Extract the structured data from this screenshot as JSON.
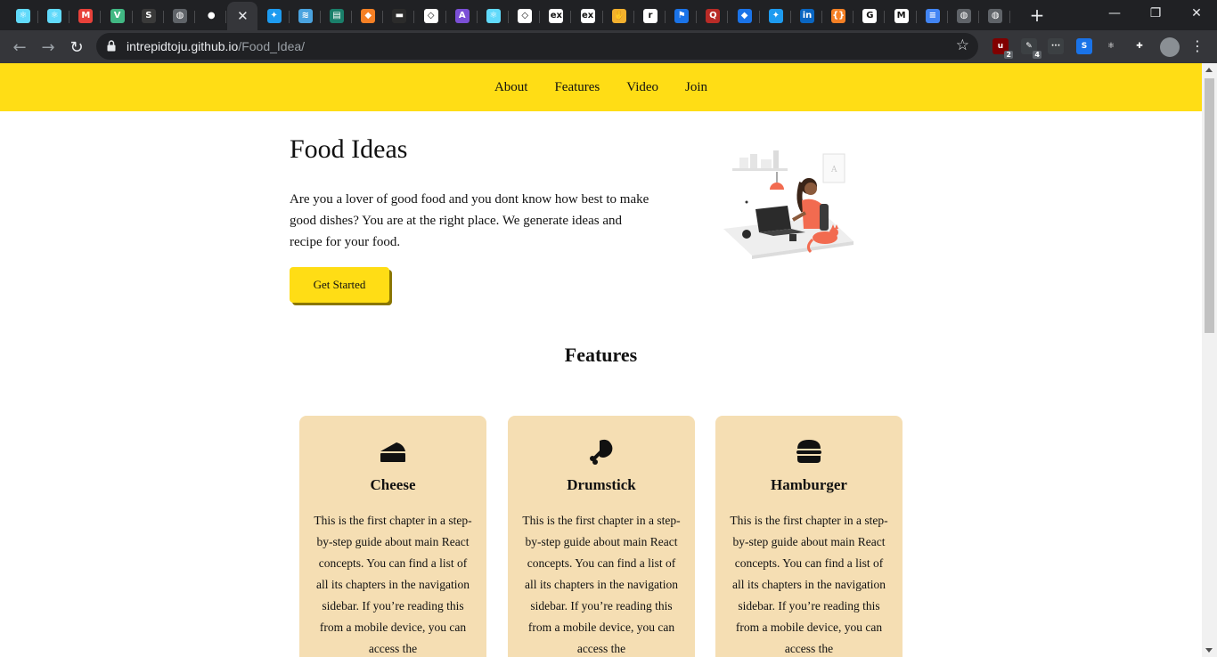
{
  "browser": {
    "tabs": [
      {
        "icon": "react-icon",
        "color": "#61dafb",
        "glyph": "⚛"
      },
      {
        "icon": "react-icon",
        "color": "#61dafb",
        "glyph": "⚛"
      },
      {
        "icon": "m-icon",
        "color": "#e8413a",
        "glyph": "M"
      },
      {
        "icon": "vue-icon",
        "color": "#41b883",
        "glyph": "V"
      },
      {
        "icon": "s-icon",
        "color": "#3a3a3a",
        "glyph": "S"
      },
      {
        "icon": "globe-icon",
        "color": "#5f6368",
        "glyph": "◍"
      },
      {
        "icon": "github-icon",
        "color": "#202124",
        "glyph": "●"
      },
      {
        "icon": "close-icon",
        "color": "#35363a",
        "glyph": "✕",
        "active": true
      },
      {
        "icon": "twitter-icon",
        "color": "#1d9bf0",
        "glyph": "✦"
      },
      {
        "icon": "wifi-icon",
        "color": "#4aa3df",
        "glyph": "≋"
      },
      {
        "icon": "book-icon",
        "color": "#1a7f6a",
        "glyph": "▤"
      },
      {
        "icon": "shield-icon",
        "color": "#f58025",
        "glyph": "◆"
      },
      {
        "icon": "terminal-icon",
        "color": "#2b2b2b",
        "glyph": "▬"
      },
      {
        "icon": "codepen-icon",
        "color": "#ffffff",
        "glyph": "◇"
      },
      {
        "icon": "a-icon",
        "color": "#7b4fd6",
        "glyph": "A"
      },
      {
        "icon": "react-icon",
        "color": "#61dafb",
        "glyph": "⚛"
      },
      {
        "icon": "codepen-icon",
        "color": "#ffffff",
        "glyph": "◇"
      },
      {
        "icon": "ex-icon",
        "color": "#ffffff",
        "glyph": "ex"
      },
      {
        "icon": "ex-icon",
        "color": "#ffffff",
        "glyph": "ex"
      },
      {
        "icon": "hand-icon",
        "color": "#f2b02e",
        "glyph": "✋"
      },
      {
        "icon": "r-icon",
        "color": "#ffffff",
        "glyph": "r"
      },
      {
        "icon": "flag-icon",
        "color": "#1a73e8",
        "glyph": "⚑"
      },
      {
        "icon": "q-icon",
        "color": "#b92b27",
        "glyph": "Q"
      },
      {
        "icon": "diamond-icon",
        "color": "#1a73e8",
        "glyph": "◆"
      },
      {
        "icon": "twitter-icon",
        "color": "#1d9bf0",
        "glyph": "✦"
      },
      {
        "icon": "linkedin-icon",
        "color": "#0a66c2",
        "glyph": "in"
      },
      {
        "icon": "brackets-icon",
        "color": "#f58025",
        "glyph": "{}"
      },
      {
        "icon": "google-icon",
        "color": "#ffffff",
        "glyph": "G"
      },
      {
        "icon": "gmail-icon",
        "color": "#ffffff",
        "glyph": "M"
      },
      {
        "icon": "docs-icon",
        "color": "#4285f4",
        "glyph": "≡"
      },
      {
        "icon": "globe-icon",
        "color": "#5f6368",
        "glyph": "◍"
      },
      {
        "icon": "globe-icon",
        "color": "#5f6368",
        "glyph": "◍"
      }
    ],
    "new_tab_glyph": "+",
    "window_controls": {
      "minimize": "—",
      "restore": "❐",
      "close": "✕"
    },
    "nav": {
      "back": "←",
      "forward": "→",
      "reload": "↻"
    },
    "url": {
      "host": "intrepidtoju.github.io",
      "path": "/Food_Idea/"
    },
    "bookmark_glyph": "☆",
    "extensions": [
      {
        "icon": "ublock-icon",
        "color": "#800000",
        "glyph": "u",
        "badge": "2"
      },
      {
        "icon": "pencil-extension-icon",
        "color": "#3c4043",
        "glyph": "✎",
        "badge": "4"
      },
      {
        "icon": "dots-extension-icon",
        "color": "#3c4043",
        "glyph": "···",
        "badge": ""
      },
      {
        "icon": "s-extension-icon",
        "color": "#1a73e8",
        "glyph": "S",
        "badge": ""
      },
      {
        "icon": "react-devtools-icon",
        "color": "#35363a",
        "glyph": "⚛",
        "badge": ""
      },
      {
        "icon": "puzzle-icon",
        "color": "#35363a",
        "glyph": "✚",
        "badge": ""
      }
    ],
    "menu_glyph": "⋮"
  },
  "site": {
    "nav": [
      "About",
      "Features",
      "Video",
      "Join"
    ],
    "hero": {
      "title": "Food Ideas",
      "text": "Are you a lover of good food and you dont know how best to make good dishes? You are at the right place. We generate ideas and recipe for your food.",
      "cta": "Get Started"
    },
    "features_title": "Features",
    "cards": [
      {
        "title": "Cheese",
        "icon": "cheese-icon",
        "text": "This is the first chapter in a step-by-step guide about main React concepts. You can find a list of all its chapters in the navigation sidebar. If you’re reading this from a mobile device, you can access the"
      },
      {
        "title": "Drumstick",
        "icon": "drumstick-icon",
        "text": "This is the first chapter in a step-by-step guide about main React concepts. You can find a list of all its chapters in the navigation sidebar. If you’re reading this from a mobile device, you can access the"
      },
      {
        "title": "Hamburger",
        "icon": "hamburger-icon",
        "text": "This is the first chapter in a step-by-step guide about main React concepts. You can find a list of all its chapters in the navigation sidebar. If you’re reading this from a mobile device, you can access the"
      }
    ],
    "colors": {
      "accent": "#ffdd15",
      "card": "#f5deb3",
      "illustration": "#f26b50"
    }
  }
}
